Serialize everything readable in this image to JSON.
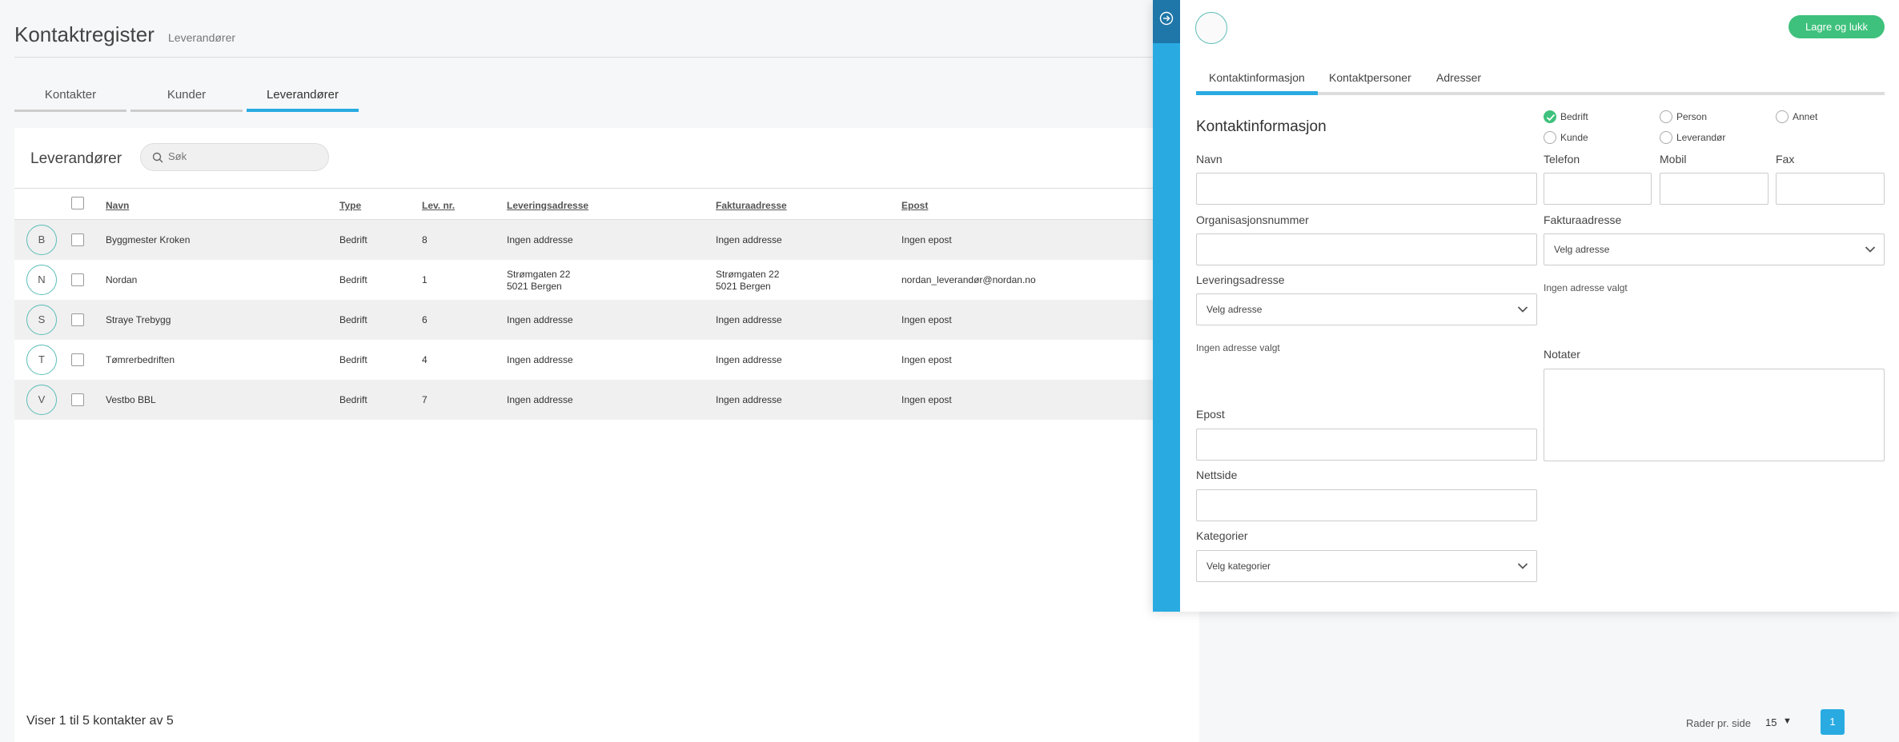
{
  "header": {
    "title": "Kontaktregister",
    "subtitle": "Leverandører"
  },
  "tabs": [
    {
      "label": "Kontakter",
      "active": false
    },
    {
      "label": "Kunder",
      "active": false
    },
    {
      "label": "Leverandører",
      "active": true
    }
  ],
  "list": {
    "title": "Leverandører",
    "search_placeholder": "Søk",
    "columns": [
      "Navn",
      "Type",
      "Lev. nr.",
      "Leveringsadresse",
      "Fakturaadresse",
      "Epost"
    ],
    "rows": [
      {
        "initial": "B",
        "name": "Byggmester Kroken",
        "type": "Bedrift",
        "lev_nr": "8",
        "lev_addr_1": "Ingen addresse",
        "lev_addr_2": "",
        "fak_addr_1": "Ingen addresse",
        "fak_addr_2": "",
        "epost": "Ingen epost"
      },
      {
        "initial": "N",
        "name": "Nordan",
        "type": "Bedrift",
        "lev_nr": "1",
        "lev_addr_1": "Strømgaten 22",
        "lev_addr_2": "5021 Bergen",
        "fak_addr_1": "Strømgaten 22",
        "fak_addr_2": "5021 Bergen",
        "epost": "nordan_leverandør@nordan.no"
      },
      {
        "initial": "S",
        "name": "Straye Trebygg",
        "type": "Bedrift",
        "lev_nr": "6",
        "lev_addr_1": "Ingen addresse",
        "lev_addr_2": "",
        "fak_addr_1": "Ingen addresse",
        "fak_addr_2": "",
        "epost": "Ingen epost"
      },
      {
        "initial": "T",
        "name": "Tømrerbedriften",
        "type": "Bedrift",
        "lev_nr": "4",
        "lev_addr_1": "Ingen addresse",
        "lev_addr_2": "",
        "fak_addr_1": "Ingen addresse",
        "fak_addr_2": "",
        "epost": "Ingen epost"
      },
      {
        "initial": "V",
        "name": "Vestbo BBL",
        "type": "Bedrift",
        "lev_nr": "7",
        "lev_addr_1": "Ingen addresse",
        "lev_addr_2": "",
        "fak_addr_1": "Ingen addresse",
        "fak_addr_2": "",
        "epost": "Ingen epost"
      }
    ]
  },
  "footer": {
    "summary": "Viser 1 til 5 kontakter av 5",
    "rows_per_page_label": "Rader pr. side",
    "rows_per_page_value": "15",
    "current_page": "1"
  },
  "panel": {
    "save_button": "Lagre og lukk",
    "tabs": [
      "Kontaktinformasjon",
      "Kontaktpersoner",
      "Adresser"
    ],
    "section_title": "Kontaktinformasjon",
    "radios": [
      {
        "label": "Bedrift",
        "checked": true
      },
      {
        "label": "Person",
        "checked": false
      },
      {
        "label": "Annet",
        "checked": false
      },
      {
        "label": "Kunde",
        "checked": false
      },
      {
        "label": "Leverandør",
        "checked": false
      }
    ],
    "fields": {
      "navn": "Navn",
      "telefon": "Telefon",
      "mobil": "Mobil",
      "fax": "Fax",
      "org": "Organisasjonsnummer",
      "fakturaadresse": "Fakturaadresse",
      "leveringsadresse": "Leveringsadresse",
      "notater": "Notater",
      "epost": "Epost",
      "nettside": "Nettside",
      "kategorier": "Kategorier"
    },
    "select_address_placeholder": "Velg adresse",
    "select_categories_placeholder": "Velg kategorier",
    "no_address_selected": "Ingen adresse valgt"
  },
  "colors": {
    "accent": "#29abe2",
    "accent_dark": "#1f76a8",
    "success": "#3ec17c",
    "avatar_border": "#5cbdb9"
  }
}
